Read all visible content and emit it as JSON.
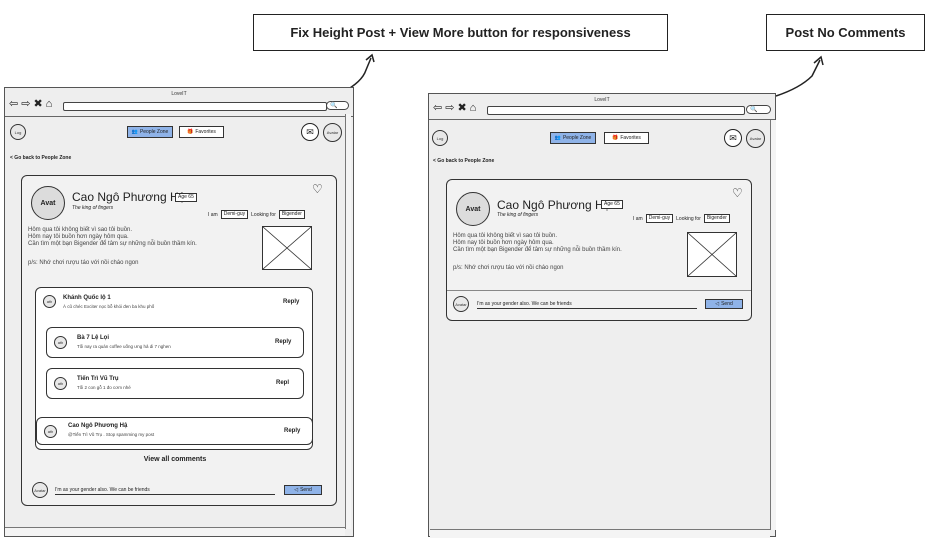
{
  "notes": {
    "left": "Fix Height Post + View More button for responsiveness",
    "right": "Post No Comments"
  },
  "window": {
    "title": "LoveIT",
    "nav_icons": [
      "⇦",
      "⇨",
      "✖",
      "⌂"
    ],
    "search_icon": "🔍"
  },
  "app": {
    "avatar_left": "Log",
    "tab_people": "People Zone",
    "tab_favorites": "Favorites",
    "avatar_right": "Avatar",
    "back": "< Go back to People Zone"
  },
  "post": {
    "avatar": "Avat",
    "name": "Cao Ngô Phương Hậu",
    "age": "Age 65",
    "tagline": "The king of fingers",
    "i_am_label": "I am",
    "i_am_value": "Demi-guy",
    "looking_label": "Looking for",
    "looking_value": "Bigender",
    "text_lines": [
      "Hôm qua tôi không biết vì sao tôi buồn.",
      "Hôm nay tôi buồn hơn ngày hôm qua.",
      "Cần tìm một bạn Bigender để tâm sự những nỗi buồn thầm kín.",
      "",
      "p/s: Nhớ chơi rượu táo với nồi cháo ngon"
    ]
  },
  "comments": [
    {
      "avatar": "ath",
      "name": "Khánh Quốc lộ 1",
      "text": "À cũ chéc Exciter nọc bỗ khói đen ba khu phố",
      "reply": "Reply"
    },
    {
      "avatar": "ath",
      "name": "Bà 7 Lệ Lọi",
      "text": "Tối nay ra quán coffee uống ưng hả di 7 nghen",
      "reply": "Reply"
    },
    {
      "avatar": "ath",
      "name": "Tiến Trì Vũ Trụ",
      "text": "Tối 2 con gỗ 1 đo cơm nhé",
      "reply": "Repl"
    },
    {
      "avatar": "ath",
      "name": "Cao Ngô Phương Hậ",
      "text": "@Tiến Trì Vũ Trụ . Stop spamming my post",
      "reply": "Reply"
    }
  ],
  "view_all": "View all comments",
  "composer": {
    "avatar": "Avatar",
    "placeholder": "I'm as your gender also. We can be friends",
    "send": "Send",
    "send_icon": "◁"
  },
  "icons": {
    "people": "👥",
    "favorites": "🎁",
    "mail": "✉",
    "heart": "♡"
  }
}
